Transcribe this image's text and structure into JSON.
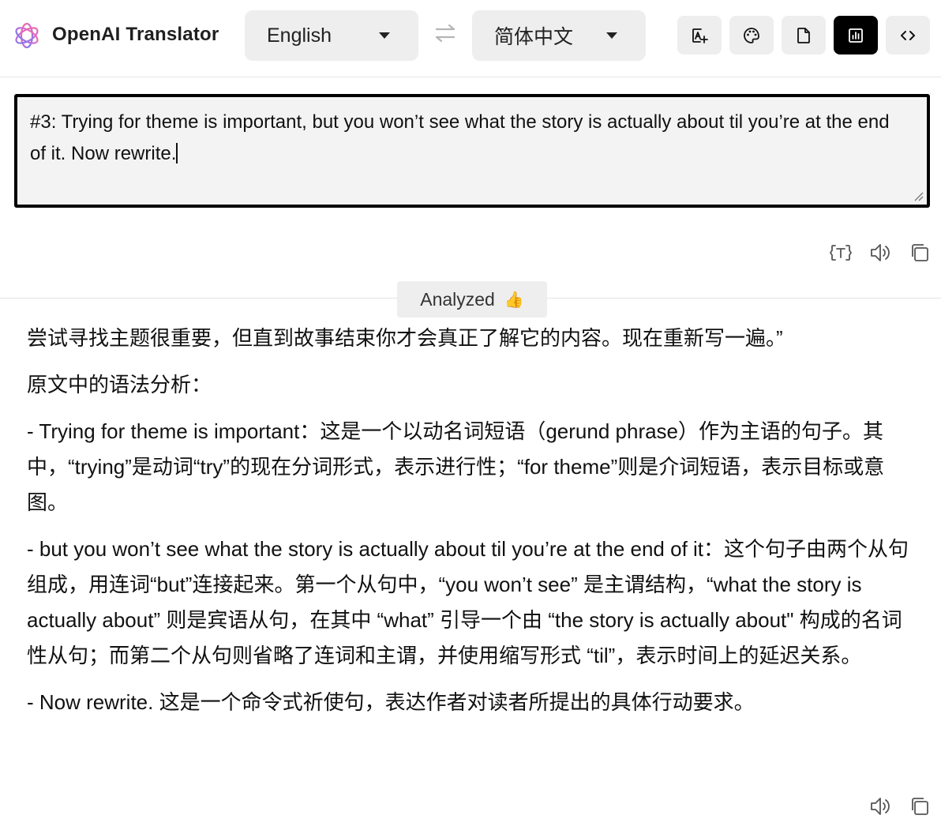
{
  "header": {
    "app_title": "OpenAI Translator",
    "source_language": "English",
    "target_language": "简体中文",
    "tools": [
      {
        "name": "add-word-icon"
      },
      {
        "name": "theme-palette-icon"
      },
      {
        "name": "file-icon"
      },
      {
        "name": "analysis-icon",
        "active": true
      },
      {
        "name": "code-icon"
      }
    ]
  },
  "input": {
    "text": "#3: Trying for theme is important, but you won’t see what the story is actually about til you’re at the end of it. Now rewrite."
  },
  "status": {
    "label": "Analyzed",
    "emoji": "👍"
  },
  "output": {
    "paragraphs": [
      "尝试寻找主题很重要，但直到故事结束你才会真正了解它的内容。现在重新写一遍。”",
      "原文中的语法分析：",
      "- Trying for theme is important：这是一个以动名词短语（gerund phrase）作为主语的句子。其中，“trying”是动词“try”的现在分词形式，表示进行性；“for theme”则是介词短语，表示目标或意图。",
      "- but you won’t see what the story is actually about til you’re at the end of it：这个句子由两个从句组成，用连词“but”连接起来。第一个从句中，“you won’t see” 是主谓结构，“what the story is actually about” 则是宾语从句，在其中 “what” 引导一个由 “the story is actually about\" 构成的名词性从句；而第二个从句则省略了连词和主谓，并使用缩写形式 “til”，表示时间上的延迟关系。",
      "- Now rewrite. 这是一个命令式祈使句，表达作者对读者所提出的具体行动要求。"
    ]
  },
  "colors": {
    "accent_active": "#000000",
    "button_bg": "#eeeeee"
  }
}
